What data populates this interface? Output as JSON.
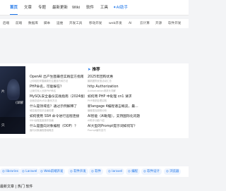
{
  "topnav": {
    "items": [
      "首页",
      "文章",
      "专题",
      "最新更新",
      "Wiki",
      "软件",
      "工具"
    ],
    "ai_label": "AI助手"
  },
  "categories": [
    "后端",
    "前端",
    "数据库",
    "脚本",
    "运维",
    "开发工具",
    "移动开发",
    "web开发",
    "AI",
    "云计算",
    "开源",
    "软件开发"
  ],
  "featured": {
    "hero_lines": [
      "片",
      "只",
      "(详解"
    ]
  },
  "recommend": {
    "heading": "推荐",
    "left_articles": [
      {
        "title": "OpenAI 出产生图最佳实践官方指南",
        "sub": "让你轻松掌握最新的生图技巧和方法"
      },
      {
        "title": "PHP命名，可能躲在？",
        "sub": "让我们深入分析PHP命名"
      },
      {
        "title": "MySQL安全备份实践指南（2024版）",
        "sub": "全面总结MySQL备份方法"
      },
      {
        "title": "什么是领域名？通过示例解释了",
        "sub": "域名相关知识全面梳理"
      },
      {
        "title": "如何使用 SSH 命令进行远程连接",
        "sub": "SSH远程连接操作指南"
      },
      {
        "title": "什么是面向对象编程（OOP）？",
        "sub": "面向对象编程基础概念"
      }
    ],
    "right_articles": [
      {
        "title": "2025年团购优惠",
        "sub": "最新团购优惠活动汇总"
      },
      {
        "title": "http Authorization",
        "sub": "Authorization请求头详解"
      },
      {
        "title": "如何用 PHP 中处理 cn1 请求",
        "sub": "PHP请求处理实践"
      },
      {
        "title": "新langage 4编程语言概览，最...",
        "sub": "编程语言趋势分析"
      },
      {
        "title": "AI智能（AI助理），支持国际化问题",
        "sub": "AI助手功能介绍"
      },
      {
        "title": "AI大型的Prompt提示词如何写？",
        "sub": "Prompt编写技巧"
      }
    ]
  },
  "tags": [
    "libraries",
    "Laravel",
    "Web前端开发",
    "软件开发",
    "软件",
    "laravel",
    "编程",
    "软件设计",
    "浏览器"
  ],
  "bottom": {
    "text": "最新文章 | 热门 软件"
  },
  "colors": {
    "accent": "#1a73e8",
    "tag_bg": "#eef4fe"
  }
}
